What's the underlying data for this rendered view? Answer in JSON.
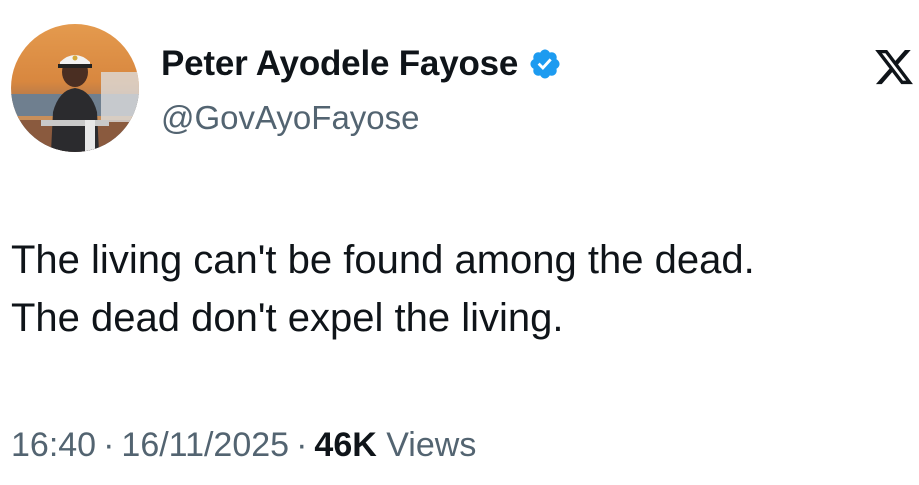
{
  "author": {
    "display_name": "Peter Ayodele Fayose",
    "handle": "@GovAyoFayose",
    "verified": true,
    "avatar_icon": "profile-photo"
  },
  "tweet": {
    "lines": [
      "The living can't be found among the dead.",
      "The dead don't expel the living."
    ]
  },
  "meta": {
    "time": "16:40",
    "date": "16/11/2025",
    "separator": "·",
    "views_count": "46K",
    "views_label": "Views"
  },
  "brand": {
    "logo_icon": "x-logo-icon",
    "verified_color": "#1d9bf0"
  }
}
